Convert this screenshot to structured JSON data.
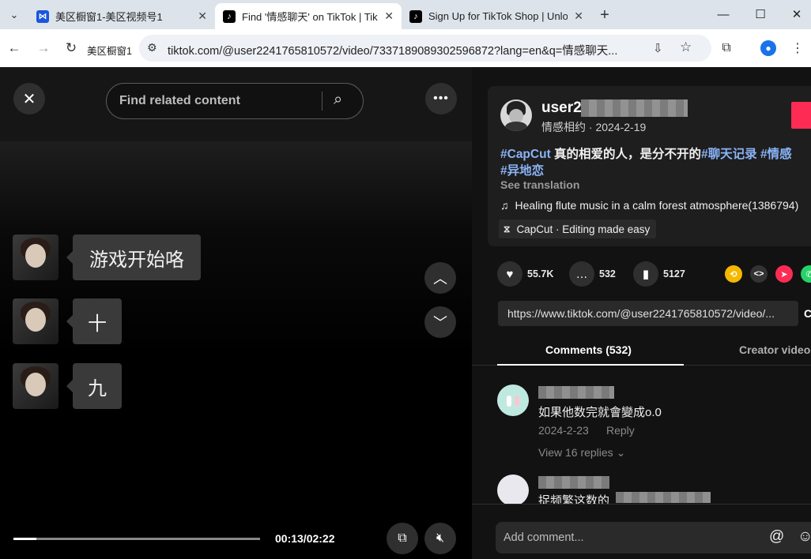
{
  "browser": {
    "tabs": [
      {
        "title": "美区橱窗1-美区视频号1",
        "favicon": "shop-icon",
        "color": "#1a56db"
      },
      {
        "title": "Find '情感聊天' on TikTok | TikTok",
        "favicon": "tiktok-icon",
        "color": "#000000"
      },
      {
        "title": "Sign Up for TikTok Shop | Unlock",
        "favicon": "tiktok-icon",
        "color": "#000000"
      }
    ],
    "url": "tiktok.com/@user2241765810572/video/7337189089302596872?lang=en&q=情感聊天...",
    "bookmark": "美区橱窗1"
  },
  "video": {
    "search_placeholder": "Find related content",
    "messages": [
      {
        "text": "游戏开始咯"
      },
      {
        "text": "十"
      },
      {
        "text": "九"
      }
    ],
    "time": "00:13/02:22",
    "progress": 0.094
  },
  "author": {
    "username": "user2",
    "subtitle": "情感相约 · 2024-2-19"
  },
  "description": {
    "line1_tag1": "#CapCut",
    "line1_text": " 真的相爱的人，是分不开的",
    "line1_tag2": "#聊天记录",
    "line1_tag3": " #情感",
    "line2_tag": "#异地恋",
    "see_translation": "See translation",
    "music": "Healing flute music in a calm forest atmosphere(1386794)",
    "capcut": "CapCut · Editing made easy"
  },
  "stats": {
    "likes": "55.7K",
    "comments": "532",
    "saves": "5127"
  },
  "link": "https://www.tiktok.com/@user2241765810572/video/...",
  "copy_label": "C",
  "panel_tabs": {
    "comments": "Comments (532)",
    "creator": "Creator videos"
  },
  "comments": [
    {
      "text": "如果他数完就會變成o.0",
      "date": "2024-2-23",
      "reply": "Reply",
      "view_replies": "View 16 replies"
    },
    {
      "text": "捉频繁这数的"
    }
  ],
  "comment_placeholder": "Add comment...",
  "colors": {
    "accent": "#fe2c55",
    "hashtag": "#8ab4f8"
  }
}
